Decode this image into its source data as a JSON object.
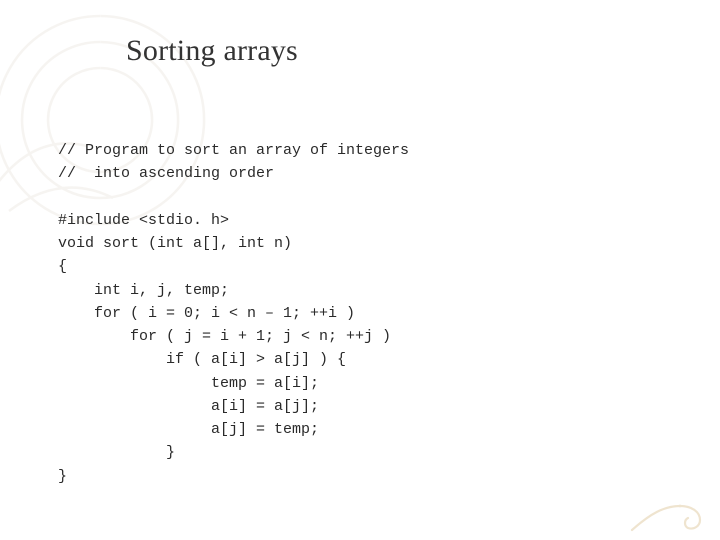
{
  "title": "Sorting arrays",
  "code": {
    "lines": [
      "// Program to sort an array of integers",
      "//  into ascending order",
      "",
      "#include <stdio. h>",
      "void sort (int a[], int n)",
      "{",
      "    int i, j, temp;",
      "    for ( i = 0; i < n – 1; ++i )",
      "        for ( j = i + 1; j < n; ++j )",
      "            if ( a[i] > a[j] ) {",
      "                 temp = a[i];",
      "                 a[i] = a[j];",
      "                 a[j] = temp;",
      "            }",
      "}"
    ]
  }
}
